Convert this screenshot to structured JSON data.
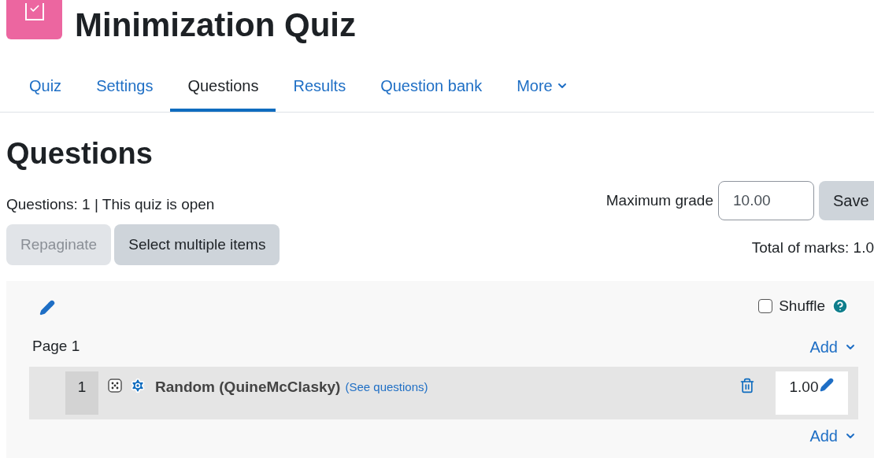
{
  "title": "Minimization Quiz",
  "tabs": [
    {
      "label": "Quiz",
      "selected": false
    },
    {
      "label": "Settings",
      "selected": false
    },
    {
      "label": "Questions",
      "selected": true
    },
    {
      "label": "Results",
      "selected": false
    },
    {
      "label": "Question bank",
      "selected": false
    },
    {
      "label": "More",
      "selected": false,
      "kind": "dropdown"
    }
  ],
  "heading": "Questions",
  "info": "Questions: 1 | This quiz is open",
  "max_grade": {
    "label": "Maximum grade",
    "value": "10.00",
    "button": "Save"
  },
  "buttons": [
    {
      "label": "Repaginate",
      "disabled": true
    },
    {
      "label": "Select multiple items",
      "disabled": false
    }
  ],
  "total_marks": "Total of marks: 1.0",
  "section": {
    "shuffle": {
      "label": "Shuffle",
      "checked": false
    },
    "page_label": "Page 1",
    "add": "Add",
    "questions": [
      {
        "number": "1",
        "name": "Random (QuineMcClasky)",
        "link": "(See questions)",
        "mark": "1.00"
      }
    ],
    "add_after": "Add"
  }
}
